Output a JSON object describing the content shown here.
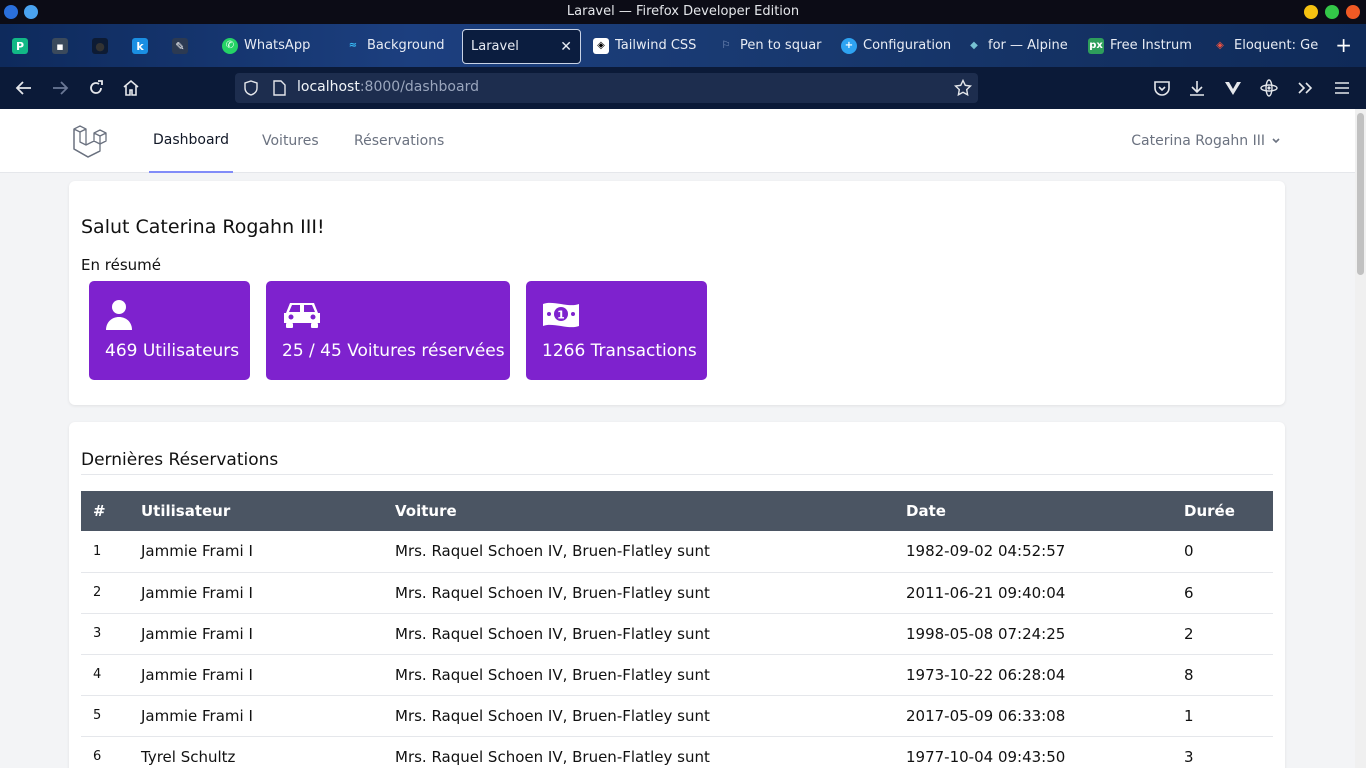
{
  "window": {
    "title": "Laravel — Firefox Developer Edition"
  },
  "tabs": [
    {
      "label": "WhatsApp",
      "icon": "whatsapp-icon"
    },
    {
      "label": "Background",
      "icon": "tailwind-icon"
    },
    {
      "label": "Laravel",
      "icon": "",
      "active": true
    },
    {
      "label": "Tailwind CSS",
      "icon": "codepen-icon"
    },
    {
      "label": "Pen to squar",
      "icon": "flag-icon"
    },
    {
      "label": "Configuration",
      "icon": "plus-circle-icon"
    },
    {
      "label": "for — Alpine",
      "icon": "alpine-icon"
    },
    {
      "label": "Free Instrum",
      "icon": "px-icon"
    },
    {
      "label": "Eloquent: Ge",
      "icon": "laravel-icon"
    }
  ],
  "url": {
    "host": "localhost",
    "rest": ":8000/dashboard"
  },
  "app": {
    "nav": {
      "dashboard": "Dashboard",
      "cars": "Voitures",
      "reservations": "Réservations"
    },
    "user": "Caterina Rogahn III"
  },
  "dashboard": {
    "greeting": "Salut Caterina Rogahn III!",
    "summary_label": "En résumé",
    "stats": {
      "users": "469 Utilisateurs",
      "cars": "25 / 45 Voitures réservées",
      "transactions": "1266 Transactions"
    },
    "accent_color": "#7e22ce"
  },
  "reservations": {
    "title": "Dernières Réservations",
    "headers": {
      "id": "#",
      "user": "Utilisateur",
      "car": "Voiture",
      "date": "Date",
      "duration": "Durée"
    },
    "rows": [
      {
        "id": "1",
        "user": "Jammie Frami I",
        "car_name": "Mrs. Raquel Schoen IV",
        "car_rest": ", Bruen-Flatley sunt",
        "date": "1982-09-02 04:52:57",
        "duration": "0"
      },
      {
        "id": "2",
        "user": "Jammie Frami I",
        "car_name": "Mrs. Raquel Schoen IV",
        "car_rest": ", Bruen-Flatley sunt",
        "date": "2011-06-21 09:40:04",
        "duration": "6"
      },
      {
        "id": "3",
        "user": "Jammie Frami I",
        "car_name": "Mrs. Raquel Schoen IV",
        "car_rest": ", Bruen-Flatley sunt",
        "date": "1998-05-08 07:24:25",
        "duration": "2"
      },
      {
        "id": "4",
        "user": "Jammie Frami I",
        "car_name": "Mrs. Raquel Schoen IV",
        "car_rest": ", Bruen-Flatley sunt",
        "date": "1973-10-22 06:28:04",
        "duration": "8"
      },
      {
        "id": "5",
        "user": "Jammie Frami I",
        "car_name": "Mrs. Raquel Schoen IV",
        "car_rest": ", Bruen-Flatley sunt",
        "date": "2017-05-09 06:33:08",
        "duration": "1"
      },
      {
        "id": "6",
        "user": "Tyrel Schultz",
        "car_name": "Mrs. Raquel Schoen IV",
        "car_rest": ", Bruen-Flatley sunt",
        "date": "1977-10-04 09:43:50",
        "duration": "3"
      }
    ]
  }
}
